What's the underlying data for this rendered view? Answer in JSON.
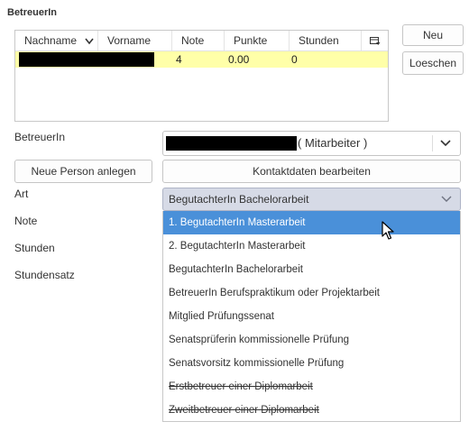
{
  "section_title": "BetreuerIn",
  "grid": {
    "headers": [
      "Nachname",
      "Vorname",
      "Note",
      "Punkte",
      "Stunden"
    ],
    "sort_indicator": "chevron-down-icon",
    "menu_icon": "column-menu-icon",
    "rows": [
      {
        "note": "4",
        "punkte": "0.00",
        "stunden": "0"
      }
    ],
    "row_color": "#ffffa8"
  },
  "buttons": {
    "neu": "Neu",
    "loeschen": "Loeschen",
    "neue_person": "Neue Person anlegen",
    "kontaktdaten": "Kontaktdaten bearbeiten"
  },
  "labels": {
    "betreuerin": "BetreuerIn",
    "art": "Art",
    "note": "Note",
    "stunden": "Stunden",
    "stundensatz": "Stundensatz"
  },
  "betreuer_select": {
    "suffix": "( Mitarbeiter )"
  },
  "art_select": {
    "value": "BegutachterIn Bachelorarbeit"
  },
  "dropdown_options": [
    {
      "label": "1. BegutachterIn Masterarbeit",
      "selected": true,
      "strike": false
    },
    {
      "label": "2. BegutachterIn Masterarbeit",
      "selected": false,
      "strike": false
    },
    {
      "label": "BegutachterIn Bachelorarbeit",
      "selected": false,
      "strike": false
    },
    {
      "label": "BetreuerIn Berufspraktikum oder Projektarbeit",
      "selected": false,
      "strike": false
    },
    {
      "label": "Mitglied Prüfungssenat",
      "selected": false,
      "strike": false
    },
    {
      "label": "Senatsprüferin kommissionelle Prüfung",
      "selected": false,
      "strike": false
    },
    {
      "label": "Senatsvorsitz kommissionelle Prüfung",
      "selected": false,
      "strike": false
    },
    {
      "label": "Erstbetreuer einer Diplomarbeit",
      "selected": false,
      "strike": true
    },
    {
      "label": "Zweitbetreuer einer Diplomarbeit",
      "selected": false,
      "strike": true
    }
  ],
  "colors": {
    "highlight": "#4a90d9",
    "select_bg": "#d6dae6"
  }
}
